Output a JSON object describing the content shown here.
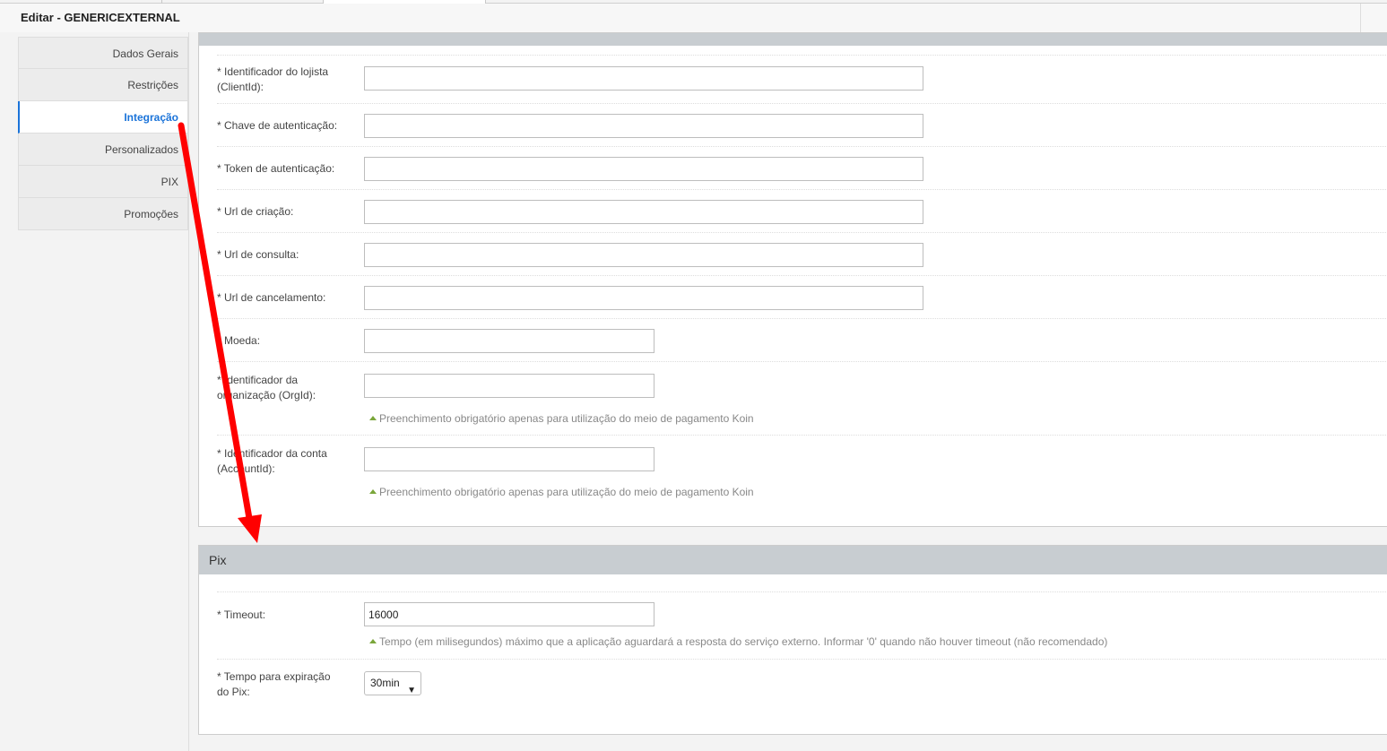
{
  "header": {
    "title": "Editar - GENERICEXTERNAL"
  },
  "sidebar": {
    "items": [
      {
        "label": "Dados Gerais"
      },
      {
        "label": "Restrições"
      },
      {
        "label": "Integração"
      },
      {
        "label": "Personalizados"
      },
      {
        "label": "PIX"
      },
      {
        "label": "Promoções"
      }
    ]
  },
  "integration": {
    "fields": [
      {
        "label": "* Identificador do lojista (ClientId):",
        "value": ""
      },
      {
        "label": "* Chave de autenticação:",
        "value": ""
      },
      {
        "label": "* Token de autenticação:",
        "value": ""
      },
      {
        "label": "* Url de criação:",
        "value": ""
      },
      {
        "label": "* Url de consulta:",
        "value": ""
      },
      {
        "label": "* Url de cancelamento:",
        "value": ""
      },
      {
        "label": "* Moeda:",
        "value": ""
      },
      {
        "label": "* Identificador da organização (OrgId):",
        "value": ""
      },
      {
        "label": "* Identificador da conta (AccountId):",
        "value": ""
      }
    ],
    "hint_koin": "Preenchimento obrigatório apenas para utilização do meio de pagamento Koin"
  },
  "pix": {
    "title": "Pix",
    "timeout_label": "* Timeout:",
    "timeout_value": "16000",
    "timeout_hint": "Tempo (em milisegundos) máximo que a aplicação aguardará a resposta do serviço externo. Informar '0' quando não houver timeout (não recomendado)",
    "expiration_label": "* Tempo para expiração do Pix:",
    "expiration_value": "30min"
  },
  "annotation": {
    "arrow_color": "#ff0000"
  }
}
